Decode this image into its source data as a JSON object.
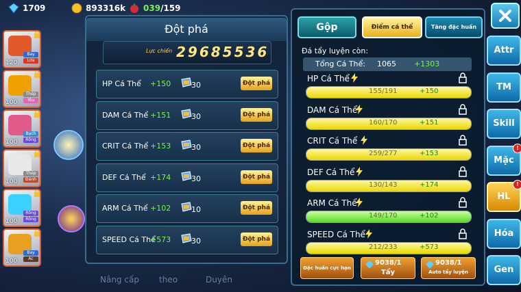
{
  "topbar": {
    "gems": "1709",
    "gold": "893316k",
    "stamina_current": "039",
    "stamina_max": "/159"
  },
  "heroes": [
    {
      "level": "120",
      "tags": [
        "Bay",
        "Lửa"
      ],
      "color": "#e25a2a",
      "tag_colors": [
        "#2d6ad8",
        "#d83a2a"
      ]
    },
    {
      "level": "100",
      "tags": [
        "Thép",
        "Yêu"
      ],
      "color": "#f0a000",
      "tag_colors": [
        "#8a8a8a",
        "#e06ab0"
      ]
    },
    {
      "level": "100",
      "tags": [
        "Bạch",
        "Rồng"
      ],
      "color": "#e05a8a",
      "tag_colors": [
        "#3a8ad8",
        "#6a4ad8"
      ]
    },
    {
      "level": "100",
      "tags": [
        "Thép",
        "Đánh"
      ],
      "color": "#e8e8e8",
      "tag_colors": [
        "#8a8a8a",
        "#c04a2a"
      ]
    },
    {
      "level": "100",
      "tags": [
        "Rồng",
        "Rồng"
      ],
      "color": "#3ad0ff",
      "tag_colors": [
        "#6a4ad8",
        "#6a4ad8"
      ]
    },
    {
      "level": "100",
      "tags": [
        "Bay",
        "Ác"
      ],
      "color": "#e8a020",
      "tag_colors": [
        "#2d6ad8",
        "#5a3a2a"
      ]
    }
  ],
  "left_panel": {
    "title": "Đột phá",
    "power_label": "Lực chiến",
    "power_value": "29685536",
    "rows": [
      {
        "name": "HP Cá Thể",
        "bonus": "+150",
        "count": "30",
        "button": "Đột phá"
      },
      {
        "name": "DAM Cá Thể",
        "bonus": "+151",
        "count": "30",
        "button": "Đột phá"
      },
      {
        "name": "CRIT Cá Thể",
        "bonus": "+153",
        "count": "30",
        "button": "Đột phá"
      },
      {
        "name": "DEF Cá Thể",
        "bonus": "+174",
        "count": "30",
        "button": "Đột phá"
      },
      {
        "name": "ARM Cá Thể",
        "bonus": "+102",
        "count": "10",
        "button": "Đột phá"
      },
      {
        "name": "SPEED Cá Thể",
        "bonus": "+573",
        "count": "30",
        "button": "Đột phá"
      }
    ],
    "bottom_labels": [
      "Nâng cấp",
      "theo",
      "Duyên"
    ]
  },
  "right_panel": {
    "tabs": [
      "Gộp",
      "Điểm cá thể",
      "Tăng đặc huấn"
    ],
    "subtitle": "Đá tẩy luyện còn:",
    "total_label": "Tổng Cá Thể:",
    "total_value": "1065",
    "total_bonus": "+1303",
    "stats": [
      {
        "name": "HP Cá Thể",
        "current": 155,
        "max": 191,
        "text": "155/191",
        "bonus": "+150",
        "full": false
      },
      {
        "name": "DAM Cá Thể",
        "current": 160,
        "max": 170,
        "text": "160/170",
        "bonus": "+151",
        "full": false
      },
      {
        "name": "CRIT Cá Thể",
        "current": 259,
        "max": 277,
        "text": "259/277",
        "bonus": "+153",
        "full": false
      },
      {
        "name": "DEF Cá Thể",
        "current": 130,
        "max": 143,
        "text": "130/143",
        "bonus": "+174",
        "full": false
      },
      {
        "name": "ARM Cá Thể",
        "current": 149,
        "max": 170,
        "text": "149/170",
        "bonus": "+102",
        "full": true
      },
      {
        "name": "SPEED Cá Thể",
        "current": 212,
        "max": 233,
        "text": "212/233",
        "bonus": "+573",
        "full": false
      }
    ],
    "buttons": [
      {
        "label": "Đặc huấn cực hạn",
        "count": ""
      },
      {
        "label": "Tẩy",
        "count": "9038/1"
      },
      {
        "label": "Auto tẩy luyện",
        "count": "9038/1"
      }
    ]
  },
  "side_buttons": [
    {
      "label": "Attr",
      "badge": false
    },
    {
      "label": "TM",
      "badge": false
    },
    {
      "label": "Skill",
      "badge": false
    },
    {
      "label": "Mặc",
      "badge": true
    },
    {
      "label": "HL",
      "badge": true,
      "active": true
    },
    {
      "label": "Hóa",
      "badge": false
    },
    {
      "label": "Gen",
      "badge": false
    }
  ],
  "badge_text": "!",
  "colors": {
    "panel_border": "#3b6d8f",
    "gold": "#ffe680",
    "green": "#7cf24a",
    "side_blue": "#1a8ad0",
    "side_active": "#f0a000"
  }
}
